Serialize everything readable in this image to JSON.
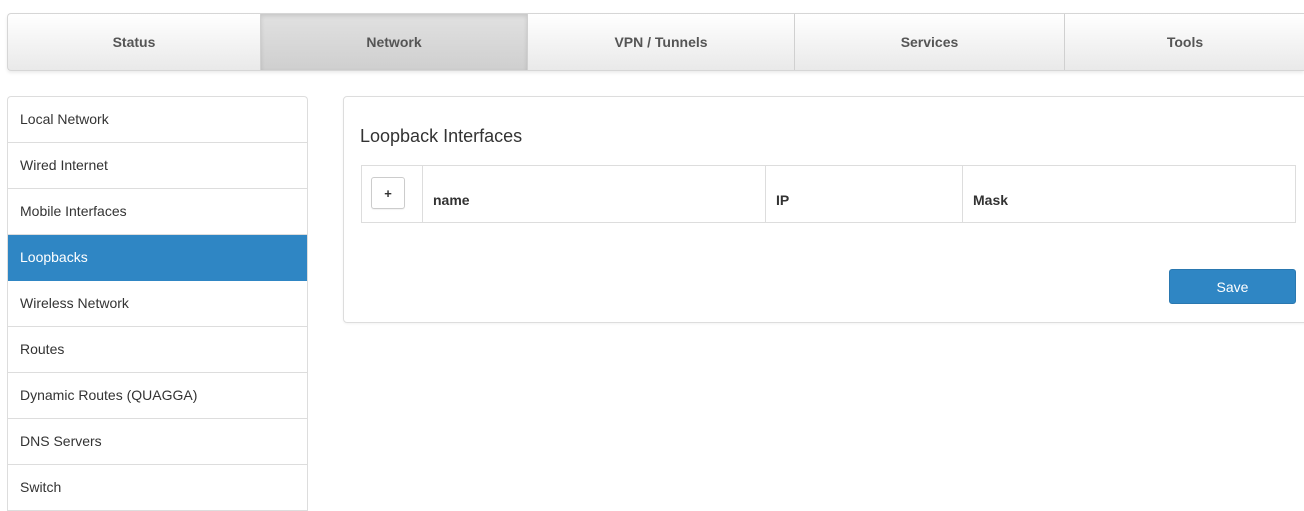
{
  "topnav": {
    "tabs": [
      {
        "label": "Status"
      },
      {
        "label": "Network"
      },
      {
        "label": "VPN / Tunnels"
      },
      {
        "label": "Services"
      },
      {
        "label": "Tools"
      }
    ],
    "active_tab": "Network"
  },
  "sidebar": {
    "items": [
      {
        "label": "Local Network"
      },
      {
        "label": "Wired Internet"
      },
      {
        "label": "Mobile Interfaces"
      },
      {
        "label": "Loopbacks"
      },
      {
        "label": "Wireless Network"
      },
      {
        "label": "Routes"
      },
      {
        "label": "Dynamic Routes (QUAGGA)"
      },
      {
        "label": "DNS Servers"
      },
      {
        "label": "Switch"
      }
    ],
    "active_item": "Loopbacks"
  },
  "main": {
    "title": "Loopback Interfaces",
    "table": {
      "add_button": "+",
      "columns": [
        "name",
        "IP",
        "Mask"
      ]
    },
    "save_label": "Save"
  },
  "colors": {
    "accent": "#2f86c4",
    "border": "#dddddd",
    "text": "#333333"
  }
}
